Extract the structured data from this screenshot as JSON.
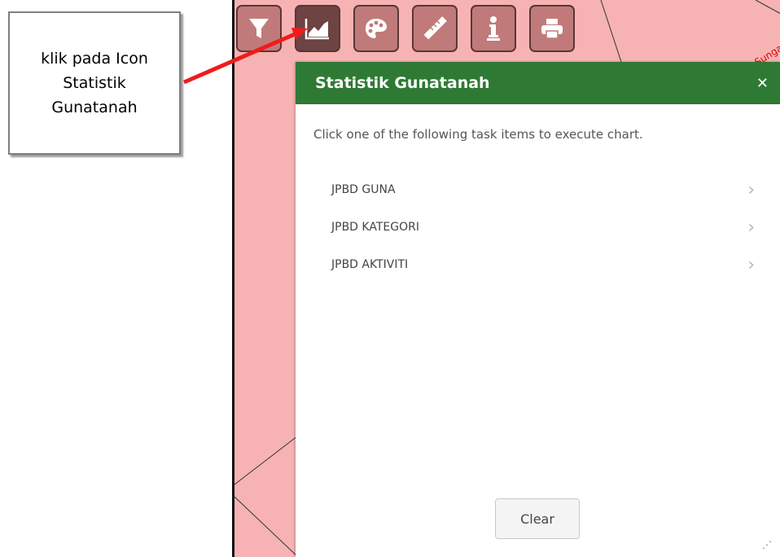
{
  "annotation": {
    "callout_text": "klik pada Icon Statistik Gunatanah",
    "arrow_color": "#ee1c1c"
  },
  "map": {
    "background": "#f7b3b3",
    "label": "Sungai"
  },
  "toolbar": {
    "tools": [
      {
        "name": "filter",
        "icon": "filter-icon",
        "active": false
      },
      {
        "name": "statistik",
        "icon": "area-chart-icon",
        "active": true
      },
      {
        "name": "symbology",
        "icon": "palette-icon",
        "active": false
      },
      {
        "name": "measure",
        "icon": "ruler-icon",
        "active": false
      },
      {
        "name": "identify",
        "icon": "info-icon",
        "active": false
      },
      {
        "name": "print",
        "icon": "print-icon",
        "active": false
      }
    ]
  },
  "panel": {
    "title": "Statistik Gunatanah",
    "close_icon": "close-icon",
    "header_color": "#2e7a34",
    "instruction": "Click one of the following task items to execute chart.",
    "tasks": [
      {
        "label": "JPBD GUNA"
      },
      {
        "label": "JPBD KATEGORI"
      },
      {
        "label": "JPBD AKTIVITI"
      }
    ],
    "clear_label": "Clear"
  }
}
